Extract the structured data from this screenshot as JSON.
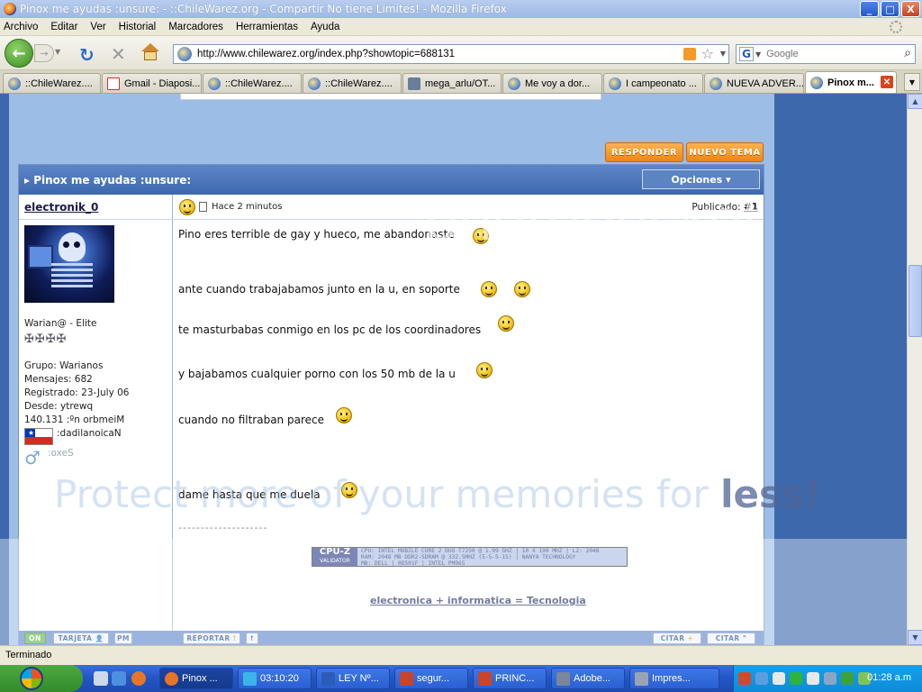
{
  "window": {
    "title": "Pinox me ayudas :unsure: - ::ChileWarez.org - Compartir No tiene Limites! - Mozilla Firefox",
    "minimize": "_",
    "maximize": "□",
    "close": "X"
  },
  "menu": [
    "Archivo",
    "Editar",
    "Ver",
    "Historial",
    "Marcadores",
    "Herramientas",
    "Ayuda"
  ],
  "nav": {
    "url": "http://www.chilewarez.org/index.php?showtopic=688131",
    "search_placeholder": "Google",
    "search_engine": "G"
  },
  "tabs": [
    {
      "label": "::ChileWarez....",
      "icon": "globe"
    },
    {
      "label": "Gmail - Diaposi...",
      "icon": "gmail"
    },
    {
      "label": "::ChileWarez....",
      "icon": "globe"
    },
    {
      "label": "::ChileWarez....",
      "icon": "globe"
    },
    {
      "label": "mega_arlu/OT...",
      "icon": "camera"
    },
    {
      "label": "Me voy a dor...",
      "icon": "globe"
    },
    {
      "label": "I campeonato ...",
      "icon": "globe"
    },
    {
      "label": "NUEVA ADVER...",
      "icon": "globe"
    },
    {
      "label": "Pinox m...",
      "icon": "globe",
      "active": true
    }
  ],
  "page": {
    "btn_reply": "RESPONDER",
    "btn_new": "NUEVO TEMA",
    "topic_title": "Pinox me ayudas :unsure:",
    "options": "Opciones ▾",
    "user": {
      "name": "electronik_0",
      "group_title": "Warian@ - Elite",
      "pips": "✠✠✠✠",
      "group": "Grupo: Warianos",
      "messages": "Mensajes: 682",
      "registered": "Registrado: 23-July 06",
      "from": "Desde: ytrewq",
      "member": "140.131 :ºn orbmeiM",
      "nationality": ":dadilanoicaN",
      "sex": ":oxeS"
    },
    "post": {
      "ago": "Hace 2 minutos",
      "published_label": "Publicado:",
      "post_number": "#1",
      "lines": [
        "Pino eres terrible de gay y hueco, me abandonaste",
        "ante cuando trabajabamos junto en la u, en soporte",
        "te masturbabas conmigo en los pc de los coordinadores",
        "y bajabamos cualquier porno con los 50 mb de la u",
        "cuando no filtraban parece",
        "dame hasta que me duela"
      ],
      "divider": "--------------------",
      "cpuz_logo": "CPU-Z",
      "cpuz_sub": "VALIDATOR",
      "cpuz_text": "CPU: INTEL MOBILE CORE 2 DUO T7250 @ 1.99 GHZ | 10 X 199 MHZ | L2: 2048\nRAM: 2048 MB DDR2-SDRAM @ 332.5MHZ (5-5-5-15) | NANYA TECHNOLOGY\nMB: DELL | 0D501F | INTEL PM965",
      "signature": "electronica + informatica = Tecnologia"
    },
    "footer": {
      "on": "ON",
      "card": "TARJETA",
      "pm": "PM",
      "report": "REPORTAR",
      "quote": "CITAR",
      "quote2": "CITAR"
    }
  },
  "watermark": {
    "brand": "photobucket",
    "text_a": "Protect more of your memories for ",
    "text_b": "less!"
  },
  "status": "Terminado",
  "taskbar": {
    "tasks": [
      {
        "label": "Pinox ...",
        "active": true,
        "color": "#e8742a"
      },
      {
        "label": "03:10:20",
        "color": "#3bb5e8"
      },
      {
        "label": "LEY Nº...",
        "color": "#2b5cb8"
      },
      {
        "label": "segur...",
        "color": "#c8442a"
      },
      {
        "label": "PRINC...",
        "color": "#c8442a"
      },
      {
        "label": "Adobe...",
        "color": "#7a8699"
      },
      {
        "label": "Impres...",
        "color": "#9aa3b5"
      }
    ],
    "clock": "01:28 a.m"
  }
}
